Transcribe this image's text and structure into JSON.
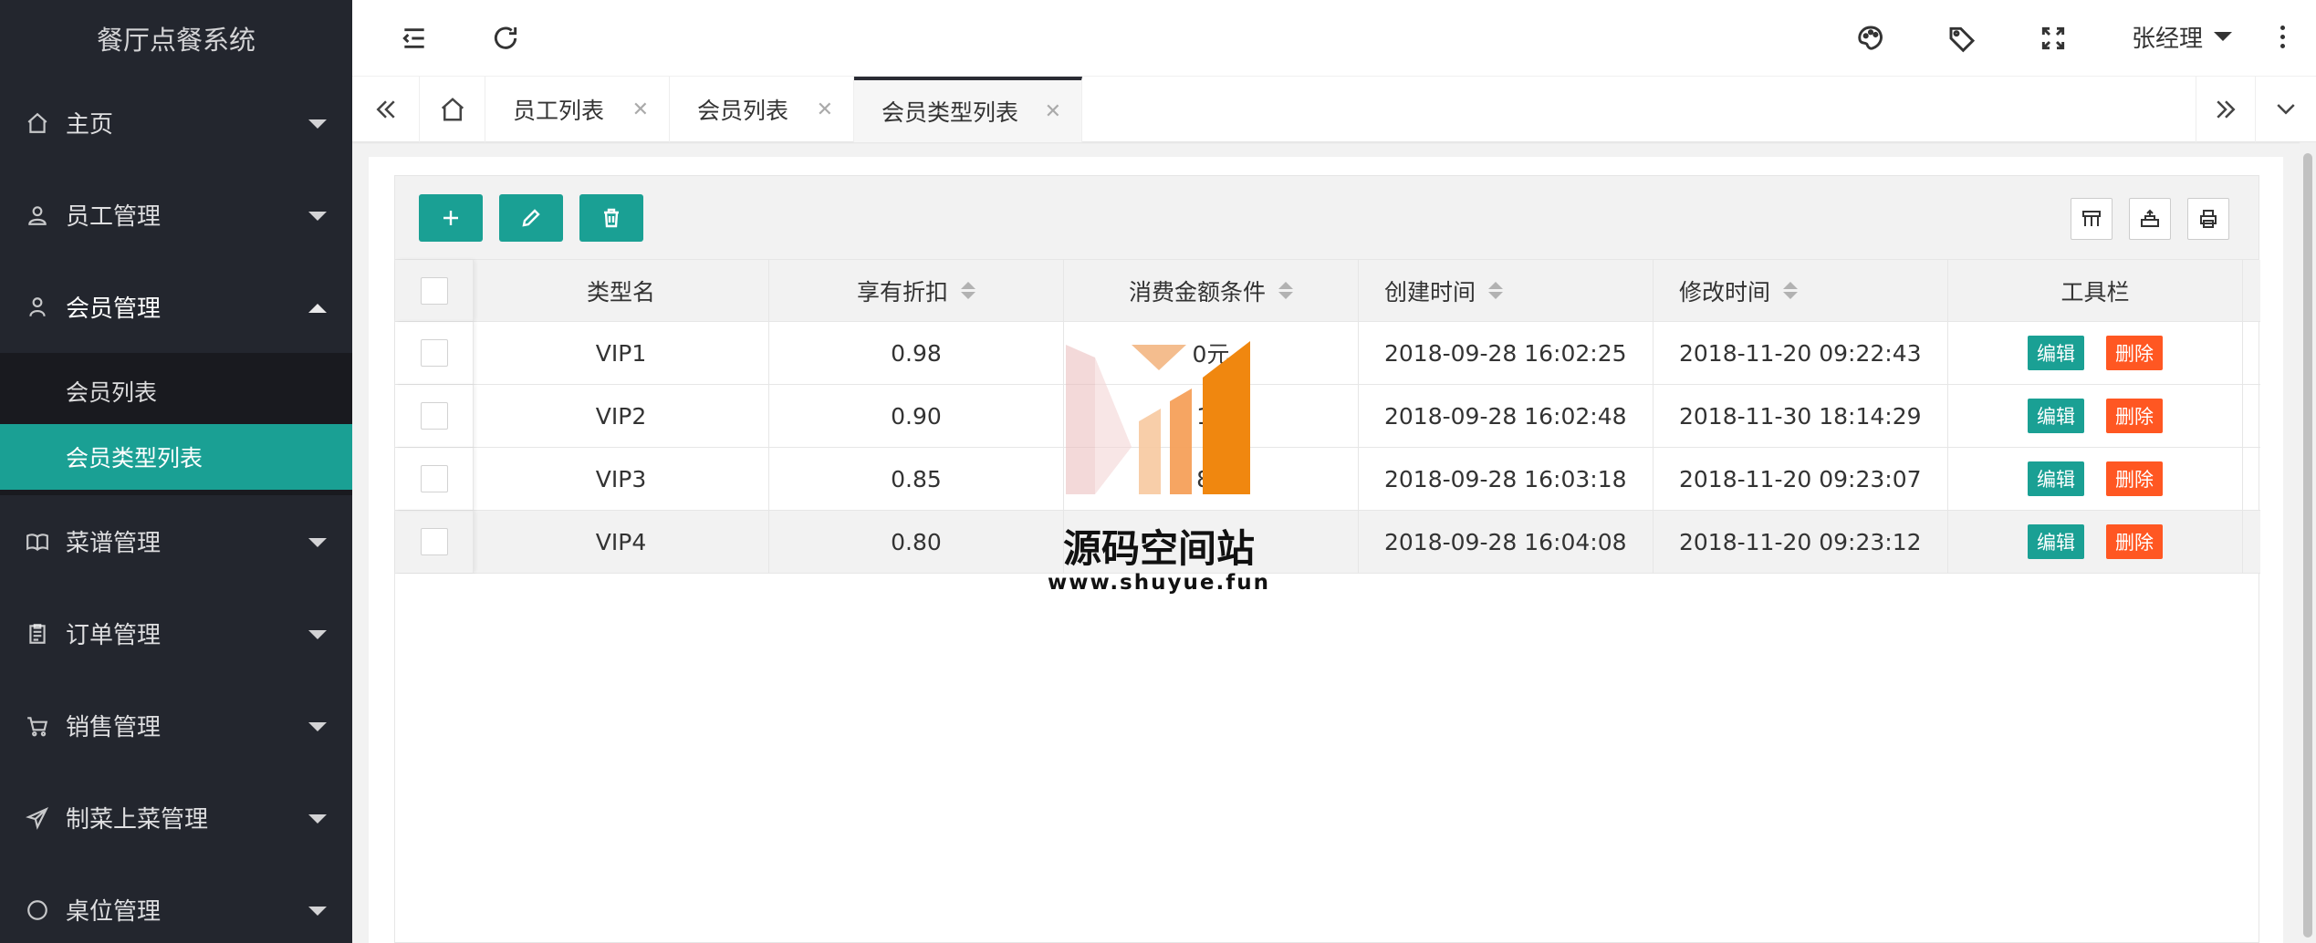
{
  "sidebar": {
    "logo": "餐厅点餐系统",
    "items": [
      {
        "label": "主页",
        "icon": "home-icon"
      },
      {
        "label": "员工管理",
        "icon": "user-icon"
      },
      {
        "label": "会员管理",
        "icon": "person-icon",
        "expanded": true,
        "children": [
          {
            "label": "会员列表"
          },
          {
            "label": "会员类型列表",
            "active": true
          }
        ]
      },
      {
        "label": "菜谱管理",
        "icon": "book-icon"
      },
      {
        "label": "订单管理",
        "icon": "clipboard-icon"
      },
      {
        "label": "销售管理",
        "icon": "cart-icon"
      },
      {
        "label": "制菜上菜管理",
        "icon": "send-icon"
      },
      {
        "label": "桌位管理",
        "icon": "circle-icon"
      }
    ]
  },
  "header": {
    "user_name": "张经理"
  },
  "tabs": [
    {
      "label": "员工列表"
    },
    {
      "label": "会员列表"
    },
    {
      "label": "会员类型列表",
      "active": true
    }
  ],
  "table": {
    "columns": [
      "类型名",
      "享有折扣",
      "消费金额条件",
      "创建时间",
      "修改时间",
      "工具栏"
    ],
    "rows": [
      {
        "name": "VIP1",
        "discount": "0.98",
        "condition": "0元",
        "created": "2018-09-28 16:02:25",
        "modified": "2018-11-20 09:22:43"
      },
      {
        "name": "VIP2",
        "discount": "0.90",
        "condition": "10",
        "created": "2018-09-28 16:02:48",
        "modified": "2018-11-30 18:14:29"
      },
      {
        "name": "VIP3",
        "discount": "0.85",
        "condition": "80",
        "created": "2018-09-28 16:03:18",
        "modified": "2018-11-20 09:23:07"
      },
      {
        "name": "VIP4",
        "discount": "0.80",
        "condition": "",
        "created": "2018-09-28 16:04:08",
        "modified": "2018-11-20 09:23:12"
      }
    ],
    "edit_label": "编辑",
    "delete_label": "删除"
  },
  "watermark": {
    "title": "源码空间站",
    "url": "www.shuyue.fun"
  },
  "colors": {
    "sidebar_bg": "#23262e",
    "accent": "#1aa094",
    "danger": "#ff5722"
  }
}
